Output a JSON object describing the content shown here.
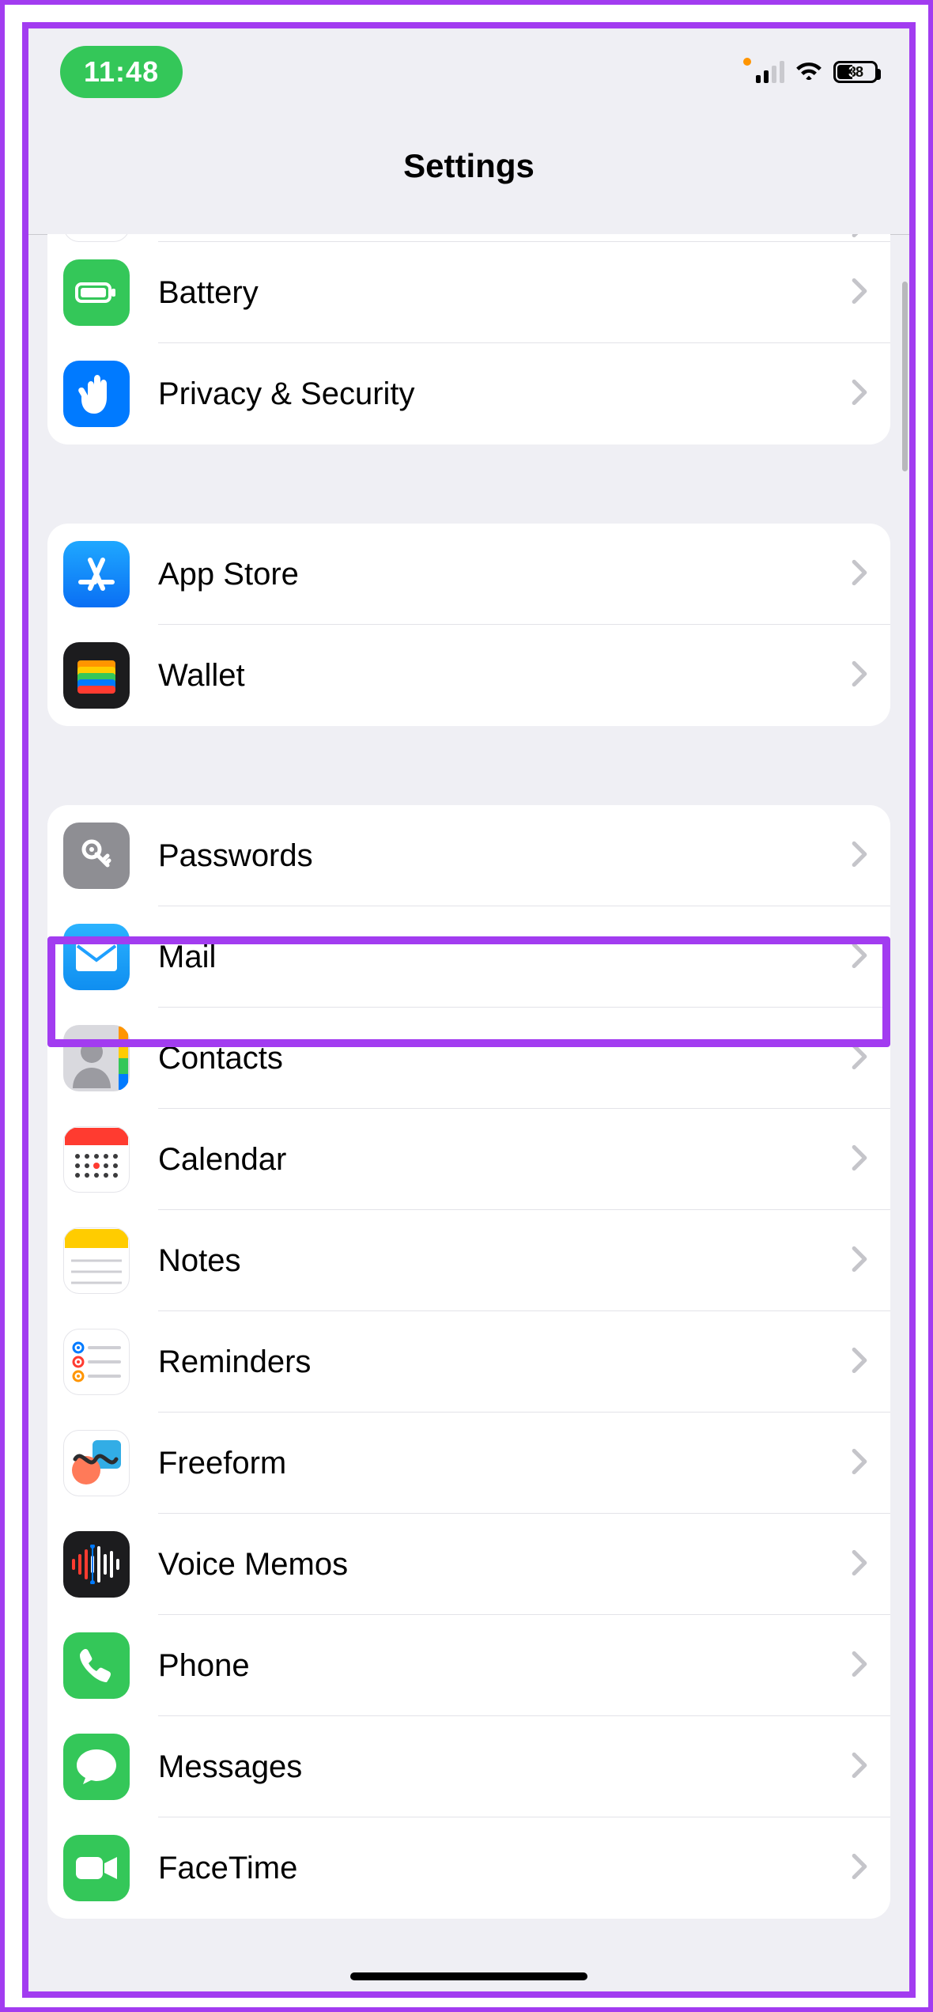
{
  "statusbar": {
    "time": "11:48",
    "battery_pct": "38"
  },
  "nav": {
    "title": "Settings"
  },
  "groups": [
    {
      "id": "system-cont",
      "rows": [
        {
          "id": "unknown-top",
          "label": "",
          "icon": "unknown-icon"
        },
        {
          "id": "battery",
          "label": "Battery",
          "icon": "battery-icon"
        },
        {
          "id": "privacy-security",
          "label": "Privacy & Security",
          "icon": "hand-raised-icon"
        }
      ]
    },
    {
      "id": "store",
      "rows": [
        {
          "id": "app-store",
          "label": "App Store",
          "icon": "appstore-icon"
        },
        {
          "id": "wallet",
          "label": "Wallet",
          "icon": "wallet-icon"
        }
      ]
    },
    {
      "id": "apps",
      "rows": [
        {
          "id": "passwords",
          "label": "Passwords",
          "icon": "key-icon"
        },
        {
          "id": "mail",
          "label": "Mail",
          "icon": "envelope-icon",
          "highlighted": true
        },
        {
          "id": "contacts",
          "label": "Contacts",
          "icon": "contacts-icon"
        },
        {
          "id": "calendar",
          "label": "Calendar",
          "icon": "calendar-icon"
        },
        {
          "id": "notes",
          "label": "Notes",
          "icon": "notes-icon"
        },
        {
          "id": "reminders",
          "label": "Reminders",
          "icon": "reminders-icon"
        },
        {
          "id": "freeform",
          "label": "Freeform",
          "icon": "freeform-icon"
        },
        {
          "id": "voice-memos",
          "label": "Voice Memos",
          "icon": "waveform-icon"
        },
        {
          "id": "phone",
          "label": "Phone",
          "icon": "phone-icon"
        },
        {
          "id": "messages",
          "label": "Messages",
          "icon": "message-bubble-icon"
        },
        {
          "id": "facetime",
          "label": "FaceTime",
          "icon": "video-icon"
        }
      ]
    }
  ]
}
